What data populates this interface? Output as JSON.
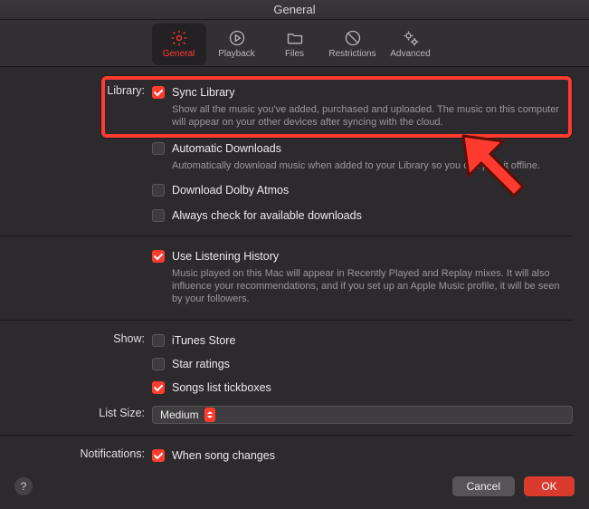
{
  "window": {
    "title": "General"
  },
  "tabs": [
    {
      "id": "general",
      "label": "General",
      "active": true
    },
    {
      "id": "playback",
      "label": "Playback",
      "active": false
    },
    {
      "id": "files",
      "label": "Files",
      "active": false
    },
    {
      "id": "restrictions",
      "label": "Restrictions",
      "active": false
    },
    {
      "id": "advanced",
      "label": "Advanced",
      "active": false
    }
  ],
  "library": {
    "label": "Library:",
    "sync": {
      "label": "Sync Library",
      "checked": true,
      "desc": "Show all the music you've added, purchased and uploaded. The music on this computer will appear on your other devices after syncing with the cloud."
    },
    "autodl": {
      "label": "Automatic Downloads",
      "checked": false,
      "desc": "Automatically download music when added to your Library so you can play it offline."
    },
    "dolby": {
      "label": "Download Dolby Atmos",
      "checked": false
    },
    "check": {
      "label": "Always check for available downloads",
      "checked": false
    }
  },
  "history": {
    "use": {
      "label": "Use Listening History",
      "checked": true,
      "desc": "Music played on this Mac will appear in Recently Played and Replay mixes. It will also influence your recommendations, and if you set up an Apple Music profile, it will be seen by your followers."
    }
  },
  "show": {
    "label": "Show:",
    "itunes": {
      "label": "iTunes Store",
      "checked": false
    },
    "stars": {
      "label": "Star ratings",
      "checked": false
    },
    "tickboxes": {
      "label": "Songs list tickboxes",
      "checked": true
    }
  },
  "listsize": {
    "label": "List Size:",
    "value": "Medium"
  },
  "notifications": {
    "label": "Notifications:",
    "song": {
      "label": "When song changes",
      "checked": true
    }
  },
  "footer": {
    "help": "?",
    "cancel": "Cancel",
    "ok": "OK"
  },
  "colors": {
    "accent": "#ff3b30"
  }
}
